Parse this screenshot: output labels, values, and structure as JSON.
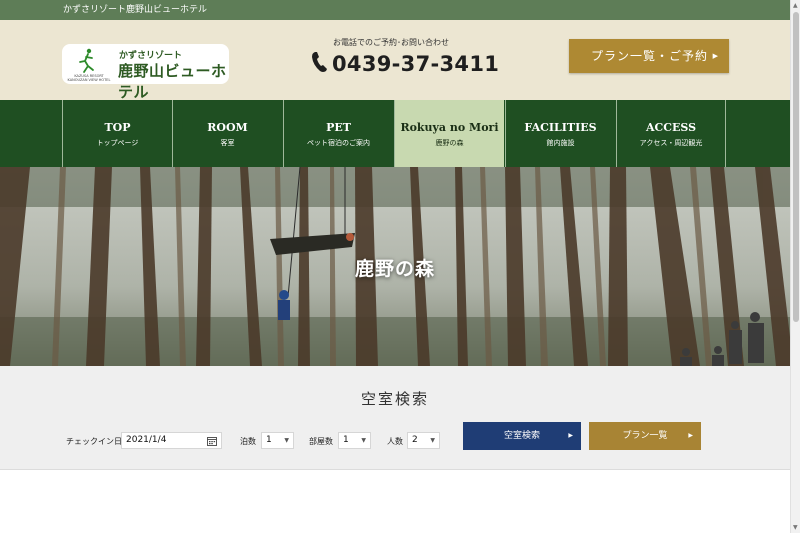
{
  "topbar": {
    "text": "かずさリゾート鹿野山ビューホテル"
  },
  "header": {
    "logo_small": "かずさリゾート",
    "logo_main": "鹿野山ビューホテル",
    "logo_sub": "KAZUSA RESORT KANOUZAN VIEW HOTEL",
    "tel_label": "お電話でのご予約･お問い合わせ",
    "tel_number": "0439-37-3411",
    "plan_button": "プラン一覧・ご予約"
  },
  "nav": {
    "items": [
      {
        "title": "TOP",
        "sub": "トップページ",
        "active": false
      },
      {
        "title": "ROOM",
        "sub": "客室",
        "active": false
      },
      {
        "title": "PET",
        "sub": "ペット宿泊のご案内",
        "active": false
      },
      {
        "title": "Rokuya no Mori",
        "sub": "鹿野の森",
        "active": true
      },
      {
        "title": "FACILITIES",
        "sub": "館内施設",
        "active": false
      },
      {
        "title": "ACCESS",
        "sub": "アクセス・周辺観光",
        "active": false
      }
    ]
  },
  "hero": {
    "title": "鹿野の森"
  },
  "search": {
    "title": "空室検索",
    "checkin_label": "チェックイン日",
    "checkin_value": "2021/1/4",
    "nights_label": "泊数",
    "nights_value": "1",
    "rooms_label": "部屋数",
    "rooms_value": "1",
    "people_label": "人数",
    "people_value": "2",
    "search_button": "空室検索",
    "plans_button": "プラン一覧"
  },
  "colors": {
    "topbar": "#5e7d57",
    "header_bg": "#ece6d2",
    "nav_bg": "#1f4f22",
    "nav_active": "#c8d9b0",
    "gold": "#ae8933",
    "navy": "#1f3d75"
  }
}
